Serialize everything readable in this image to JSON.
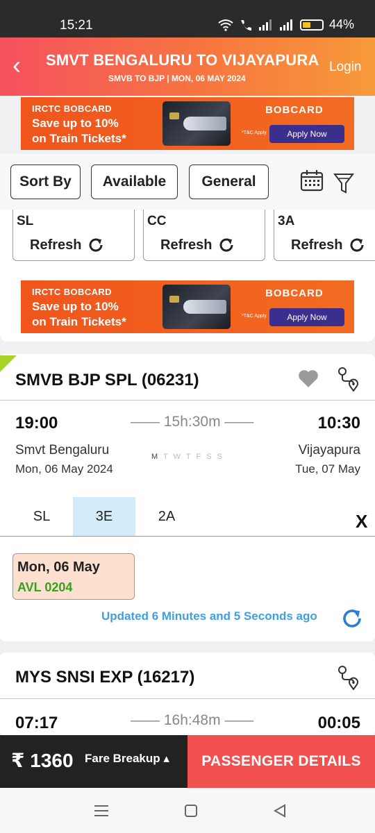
{
  "status_bar": {
    "time": "15:21",
    "battery_pct": "44%",
    "battery_level": 0.44
  },
  "header": {
    "back_icon": "chevron-left-icon",
    "title": "SMVT BENGALURU TO VIJAYAPURA",
    "subtitle": "SMVB TO BJP | MON, 06 MAY  2024",
    "login": "Login"
  },
  "ad": {
    "brand": "IRCTC BOBCARD",
    "line1": "Save up to 10%",
    "line2": "on Train Tickets*",
    "logo": "BOBCARD",
    "tc": "*T&C Apply",
    "cta": "Apply Now"
  },
  "filters": {
    "sort_by": "Sort By",
    "available": "Available",
    "general": "General"
  },
  "class_tiles": [
    {
      "class": "SL",
      "action": "Refresh"
    },
    {
      "class": "CC",
      "action": "Refresh"
    },
    {
      "class": "3A",
      "action": "Refresh"
    }
  ],
  "train1": {
    "name": "SMVB BJP SPL (06231)",
    "depart_time": "19:00",
    "duration": "15h:30m",
    "arrive_time": "10:30",
    "from_station": "Smvt Bengaluru",
    "to_station": "Vijayapura",
    "depart_date": "Mon, 06 May  2024",
    "arrive_date": "Tue, 07 May",
    "days": [
      "M",
      "T",
      "W",
      "T",
      "F",
      "S",
      "S"
    ],
    "classes": [
      "SL",
      "3E",
      "2A"
    ],
    "selected_class": "3E",
    "close": "X",
    "availability_date": "Mon, 06 May",
    "availability_status": "AVL 0204",
    "updated": "Updated 6 Minutes and 5 Seconds ago"
  },
  "train2": {
    "name": "MYS SNSI EXP (16217)",
    "depart_time": "07:17",
    "duration": "16h:48m",
    "arrive_time": "00:05"
  },
  "bottom": {
    "fare": "₹ 1360",
    "fare_breakup": "Fare Breakup ▴",
    "cta": "PASSENGER DETAILS"
  },
  "colors": {
    "header_start": "#f5515f",
    "header_end": "#f79a3a",
    "selected_tab": "#d4ecfa",
    "available_green": "#34a31b",
    "updated_blue": "#3ea0e0",
    "cta_red": "#f1504f"
  }
}
